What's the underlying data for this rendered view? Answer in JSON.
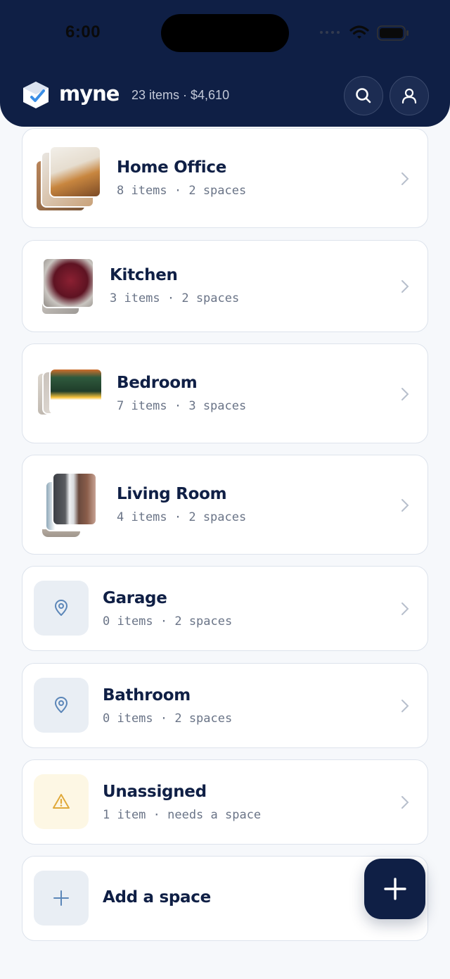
{
  "status_bar": {
    "time": "6:00"
  },
  "header": {
    "brand": "myne",
    "summary": "23 items · $4,610",
    "icons": [
      "search-icon",
      "profile-icon"
    ]
  },
  "spaces": [
    {
      "name": "Home Office",
      "meta": "8 items · 2 spaces",
      "thumb": "photos"
    },
    {
      "name": "Kitchen",
      "meta": "3 items · 2 spaces",
      "thumb": "photos"
    },
    {
      "name": "Bedroom",
      "meta": "7 items · 3 spaces",
      "thumb": "photos"
    },
    {
      "name": "Living Room",
      "meta": "4 items · 2 spaces",
      "thumb": "photos"
    },
    {
      "name": "Garage",
      "meta": "0 items · 2 spaces",
      "thumb": "location-pin-icon"
    },
    {
      "name": "Bathroom",
      "meta": "0 items · 2 spaces",
      "thumb": "location-pin-icon"
    },
    {
      "name": "Unassigned",
      "meta": "1 item · needs a space",
      "thumb": "warning-icon"
    }
  ],
  "add_space": {
    "label": "Add a space",
    "icon": "plus-icon"
  },
  "fab": {
    "icon": "plus-icon"
  },
  "colors": {
    "navy": "#0f1f45",
    "warning": "#e0a93a",
    "tile": "#e9eef4"
  }
}
